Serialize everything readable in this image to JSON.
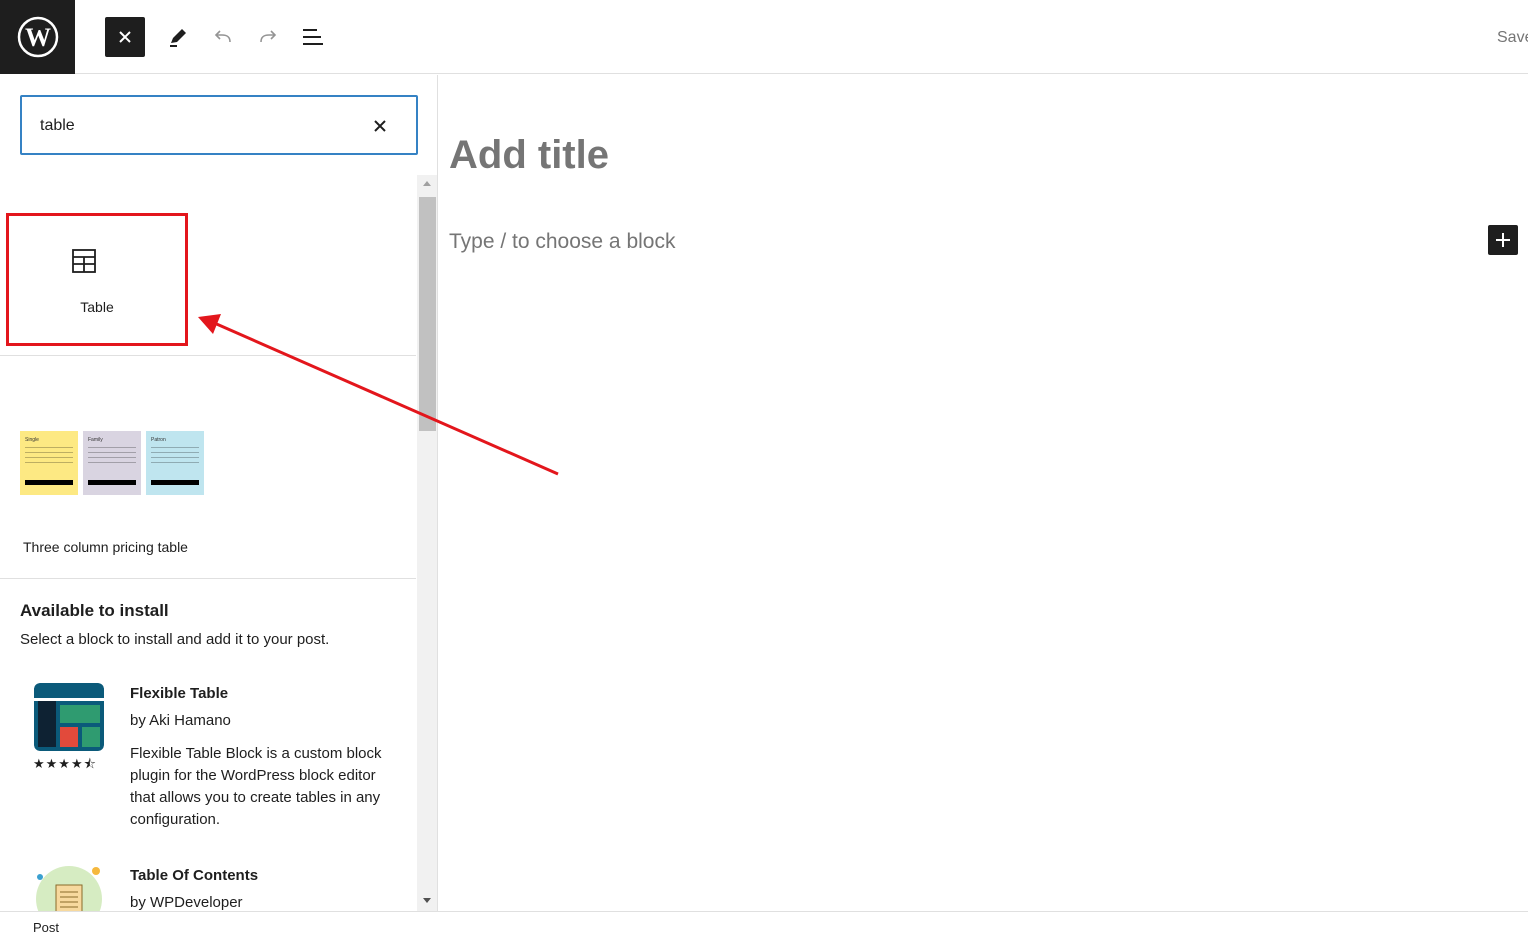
{
  "header": {
    "logo_icon": "wordpress-logo-icon",
    "close_icon": "close-icon",
    "tools": [
      "pencil-icon",
      "undo-icon",
      "redo-icon",
      "list-view-icon"
    ],
    "save_label": "Save draft"
  },
  "inserter": {
    "search_value": "table",
    "search_clear_icon": "close-icon",
    "block_result": {
      "label": "Table",
      "icon": "table-icon"
    },
    "pattern": {
      "label": "Three column pricing table",
      "columns": [
        {
          "title": "Single",
          "color": "#fde983"
        },
        {
          "title": "Family",
          "color": "#d9d4e1"
        },
        {
          "title": "Patron",
          "color": "#bfe5ef"
        }
      ]
    },
    "install": {
      "heading": "Available to install",
      "description": "Select a block to install and add it to your post.",
      "plugins": [
        {
          "title": "Flexible Table",
          "author": "by Aki Hamano",
          "rating": "★★★★⯪",
          "description": "Flexible Table Block is a custom block plugin for the WordPress block editor that allows you to create tables in any configuration."
        },
        {
          "title": "Table Of Contents",
          "author": "by WPDeveloper"
        }
      ]
    }
  },
  "editor": {
    "title_placeholder": "Add title",
    "block_placeholder": "Type / to choose a block",
    "add_block_icon": "plus-icon"
  },
  "footer": {
    "breadcrumb": "Post"
  },
  "annotation": {
    "color": "#e3161c"
  }
}
